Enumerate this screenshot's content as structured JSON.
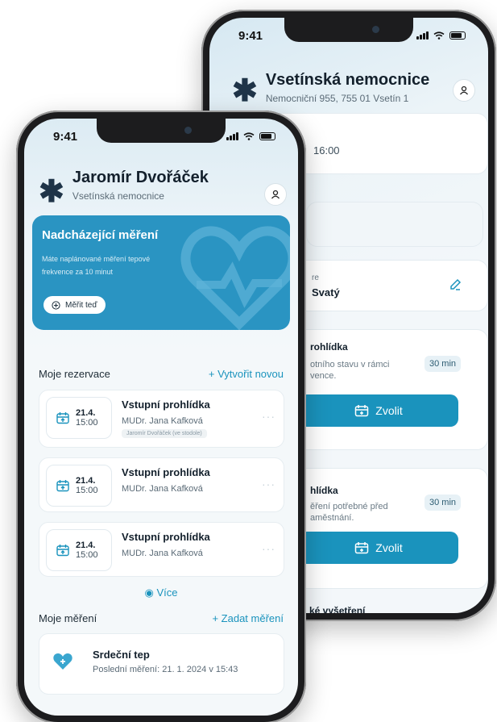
{
  "back_phone": {
    "status": {
      "time": "9:41"
    },
    "header": {
      "title": "Vsetínská nemocnice",
      "address": "Nemocniční 955, 755 01 Vsetín 1"
    },
    "time_card": {
      "time": "16:00"
    },
    "doctor_card": {
      "label": "re",
      "name": "Svatý"
    },
    "services": [
      {
        "title": "rohlídka",
        "desc_line1": "otního stavu v rámci",
        "desc_line2": "vence.",
        "duration": "30 min",
        "button": "Zvolit"
      },
      {
        "title": "hlídka",
        "desc_line1": "ěření potřebné před",
        "desc_line2": "aměstnání.",
        "duration": "30 min",
        "button": "Zvolit"
      }
    ],
    "bottom_text": "ké vyšetření"
  },
  "front_phone": {
    "status": {
      "time": "9:41"
    },
    "header": {
      "name": "Jaromír Dvořáček",
      "hospital": "Vsetínská nemocnice"
    },
    "upcoming": {
      "title": "Nadcházející měření",
      "text": "Máte naplánované měření tepové frekvence za 10 minut",
      "button": "Měřit teď"
    },
    "reservations": {
      "label": "Moje rezervace",
      "action": "+ Vytvořit novou",
      "items": [
        {
          "date": "21.4.",
          "time": "15:00",
          "title": "Vstupní prohlídka",
          "doctor": "MUDr. Jana Kafková",
          "patient": "Jaromír Dvořáček (ve stodole)"
        },
        {
          "date": "21.4.",
          "time": "15:00",
          "title": "Vstupní prohlídka",
          "doctor": "MUDr. Jana Kafková"
        },
        {
          "date": "21.4.",
          "time": "15:00",
          "title": "Vstupní prohlídka",
          "doctor": "MUDr. Jana Kafková"
        }
      ],
      "more": "Více"
    },
    "measurements": {
      "label": "Moje měření",
      "action": "+ Zadat měření",
      "item": {
        "title": "Srdeční tep",
        "last": "Poslední měření: 21. 1. 2024 v 15:43"
      }
    }
  },
  "colors": {
    "accent": "#1a93bd",
    "hero": "#2a94c2",
    "dark": "#13202c"
  }
}
